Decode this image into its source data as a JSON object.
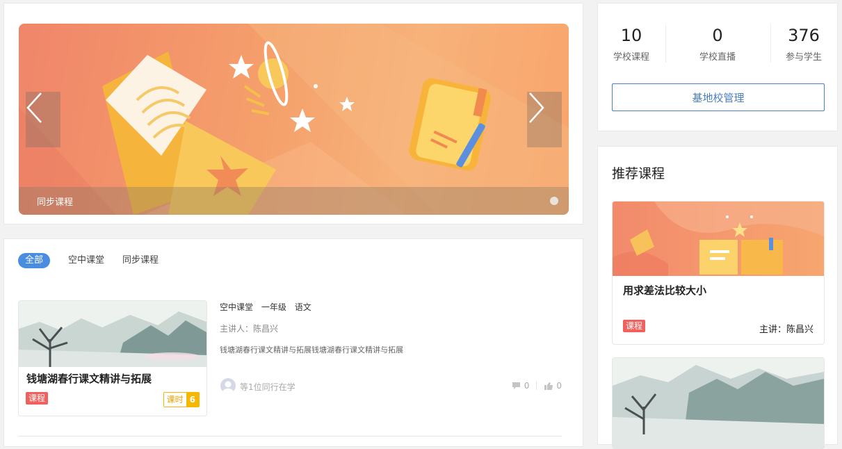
{
  "banner": {
    "caption": "同步课程",
    "prev_icon": "chevron-left-icon",
    "next_icon": "chevron-right-icon"
  },
  "tabs": [
    {
      "label": "全部",
      "active": true
    },
    {
      "label": "空中课堂",
      "active": false
    },
    {
      "label": "同步课程",
      "active": false
    }
  ],
  "course": {
    "title": "钱塘湖春行课文精讲与拓展",
    "tag": "课程",
    "lesson_label": "课时",
    "lesson_count": "6",
    "meta": [
      "空中课堂",
      "一年级",
      "语文"
    ],
    "speaker": "主讲人：陈昌兴",
    "description": "钱塘湖春行课文精讲与拓展钱塘湖春行课文精讲与拓展",
    "learners": "等1位同行在学",
    "comments": "0",
    "likes": "0"
  },
  "stats": [
    {
      "value": "10",
      "label": "学校课程"
    },
    {
      "value": "0",
      "label": "学校直播"
    },
    {
      "value": "376",
      "label": "参与学生"
    }
  ],
  "manage_button": "基地校管理",
  "recommended": {
    "title": "推荐课程",
    "items": [
      {
        "name": "用求差法比较大小",
        "tag": "课程",
        "speaker": "主讲：陈昌兴"
      }
    ]
  },
  "colors": {
    "accent": "#4a8de0",
    "tag_red": "#f0605d",
    "lesson_yellow": "#f5b700",
    "button_blue": "#4a7fc0"
  }
}
